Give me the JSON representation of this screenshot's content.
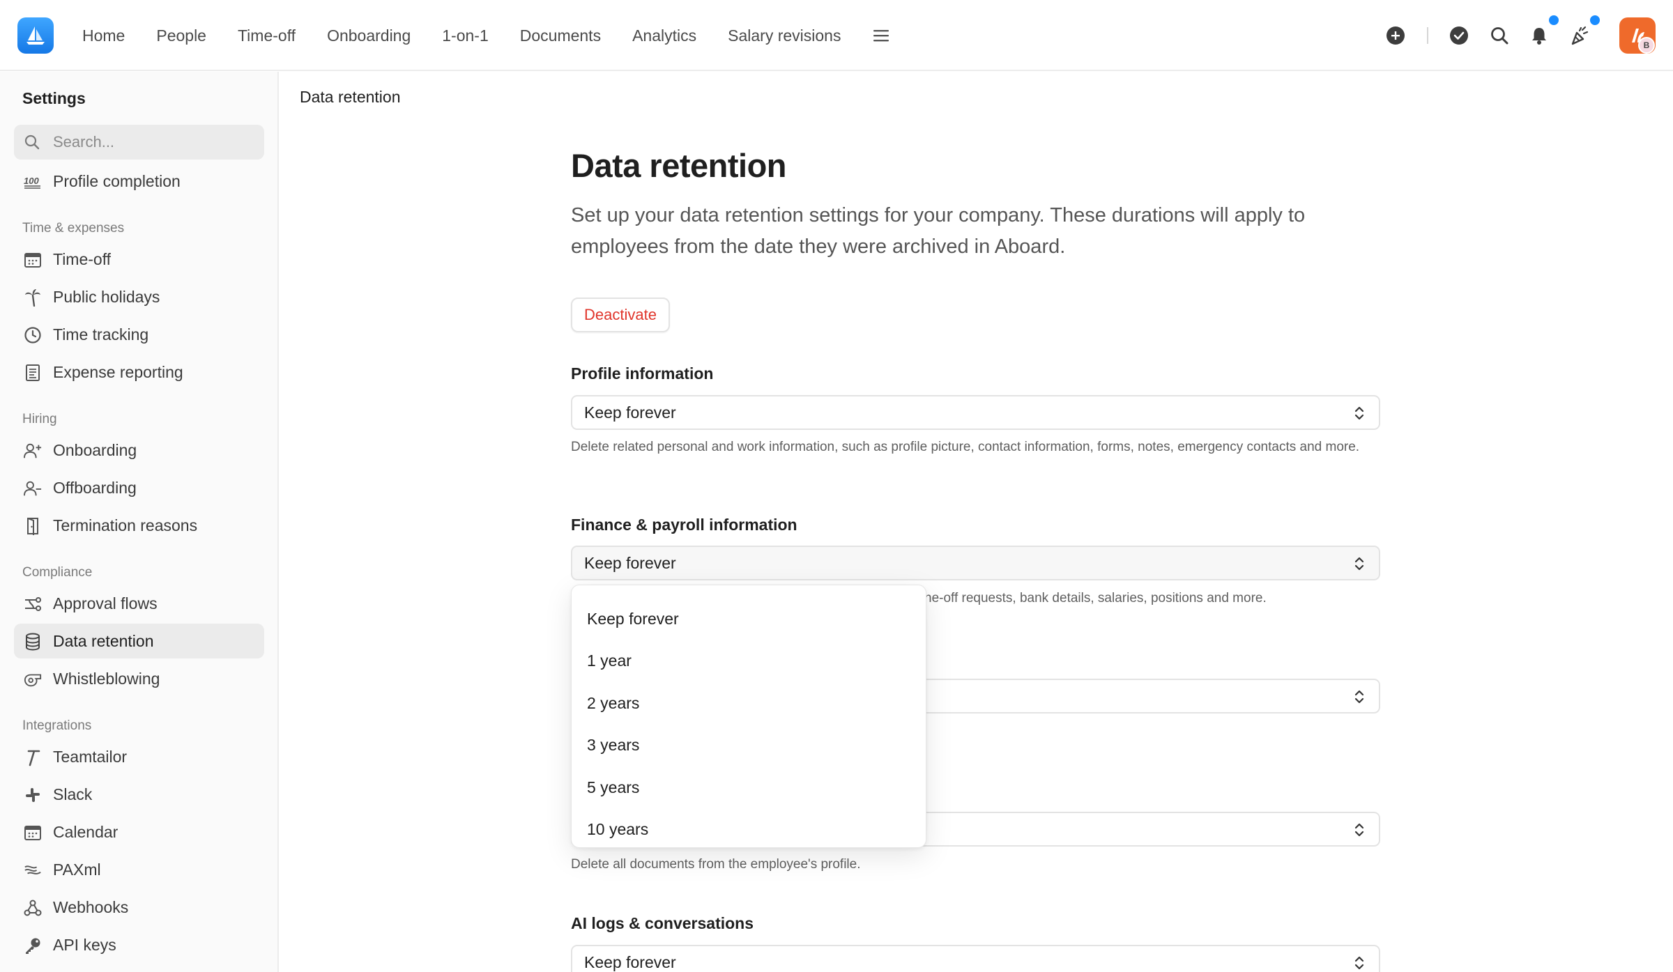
{
  "app": {
    "nav": [
      {
        "label": "Home"
      },
      {
        "label": "People"
      },
      {
        "label": "Time-off"
      },
      {
        "label": "Onboarding"
      },
      {
        "label": "1-on-1"
      },
      {
        "label": "Documents"
      },
      {
        "label": "Analytics"
      },
      {
        "label": "Salary revisions"
      }
    ],
    "avatar_badge": "B",
    "accent_color": "#1a8cff",
    "avatar_color": "#ef6a2b"
  },
  "sidebar": {
    "title": "Settings",
    "search_placeholder": "Search...",
    "top_item": {
      "label": "Profile completion",
      "icon": "hundred-icon"
    },
    "sections": [
      {
        "title": "Time & expenses",
        "items": [
          {
            "label": "Time-off",
            "icon": "calendar-icon"
          },
          {
            "label": "Public holidays",
            "icon": "palm-tree-icon"
          },
          {
            "label": "Time tracking",
            "icon": "clock-icon"
          },
          {
            "label": "Expense reporting",
            "icon": "receipt-icon"
          }
        ]
      },
      {
        "title": "Hiring",
        "items": [
          {
            "label": "Onboarding",
            "icon": "user-plus-icon"
          },
          {
            "label": "Offboarding",
            "icon": "user-minus-icon"
          },
          {
            "label": "Termination reasons",
            "icon": "door-icon"
          }
        ]
      },
      {
        "title": "Compliance",
        "items": [
          {
            "label": "Approval flows",
            "icon": "flow-icon"
          },
          {
            "label": "Data retention",
            "icon": "database-icon",
            "active": true
          },
          {
            "label": "Whistleblowing",
            "icon": "whistle-icon"
          }
        ]
      },
      {
        "title": "Integrations",
        "items": [
          {
            "label": "Teamtailor",
            "icon": "teamtailor-icon"
          },
          {
            "label": "Slack",
            "icon": "slack-icon"
          },
          {
            "label": "Calendar",
            "icon": "calendar-icon"
          },
          {
            "label": "PAXml",
            "icon": "paxml-icon"
          },
          {
            "label": "Webhooks",
            "icon": "webhook-icon"
          },
          {
            "label": "API keys",
            "icon": "key-icon"
          }
        ]
      }
    ]
  },
  "main": {
    "breadcrumb": "Data retention",
    "title": "Data retention",
    "description": "Set up your data retention settings for your company. These durations will apply to employees from the date they were archived in Aboard.",
    "deactivate_label": "Deactivate",
    "fields": [
      {
        "label": "Profile information",
        "value": "Keep forever",
        "help": "Delete related personal and work information, such as profile picture, contact information, forms, notes, emergency contacts and more."
      },
      {
        "label": "Finance & payroll information",
        "value": "Keep forever",
        "help_visible": "ne-off requests, bank details, salaries, positions and more."
      },
      {
        "label": "",
        "value": ""
      },
      {
        "label": "",
        "value": "",
        "help": "Delete all documents from the employee's profile."
      },
      {
        "label": "AI logs & conversations",
        "value": "Keep forever"
      }
    ],
    "dropdown_options": [
      "Keep forever",
      "1 year",
      "2 years",
      "3 years",
      "5 years",
      "10 years"
    ]
  }
}
